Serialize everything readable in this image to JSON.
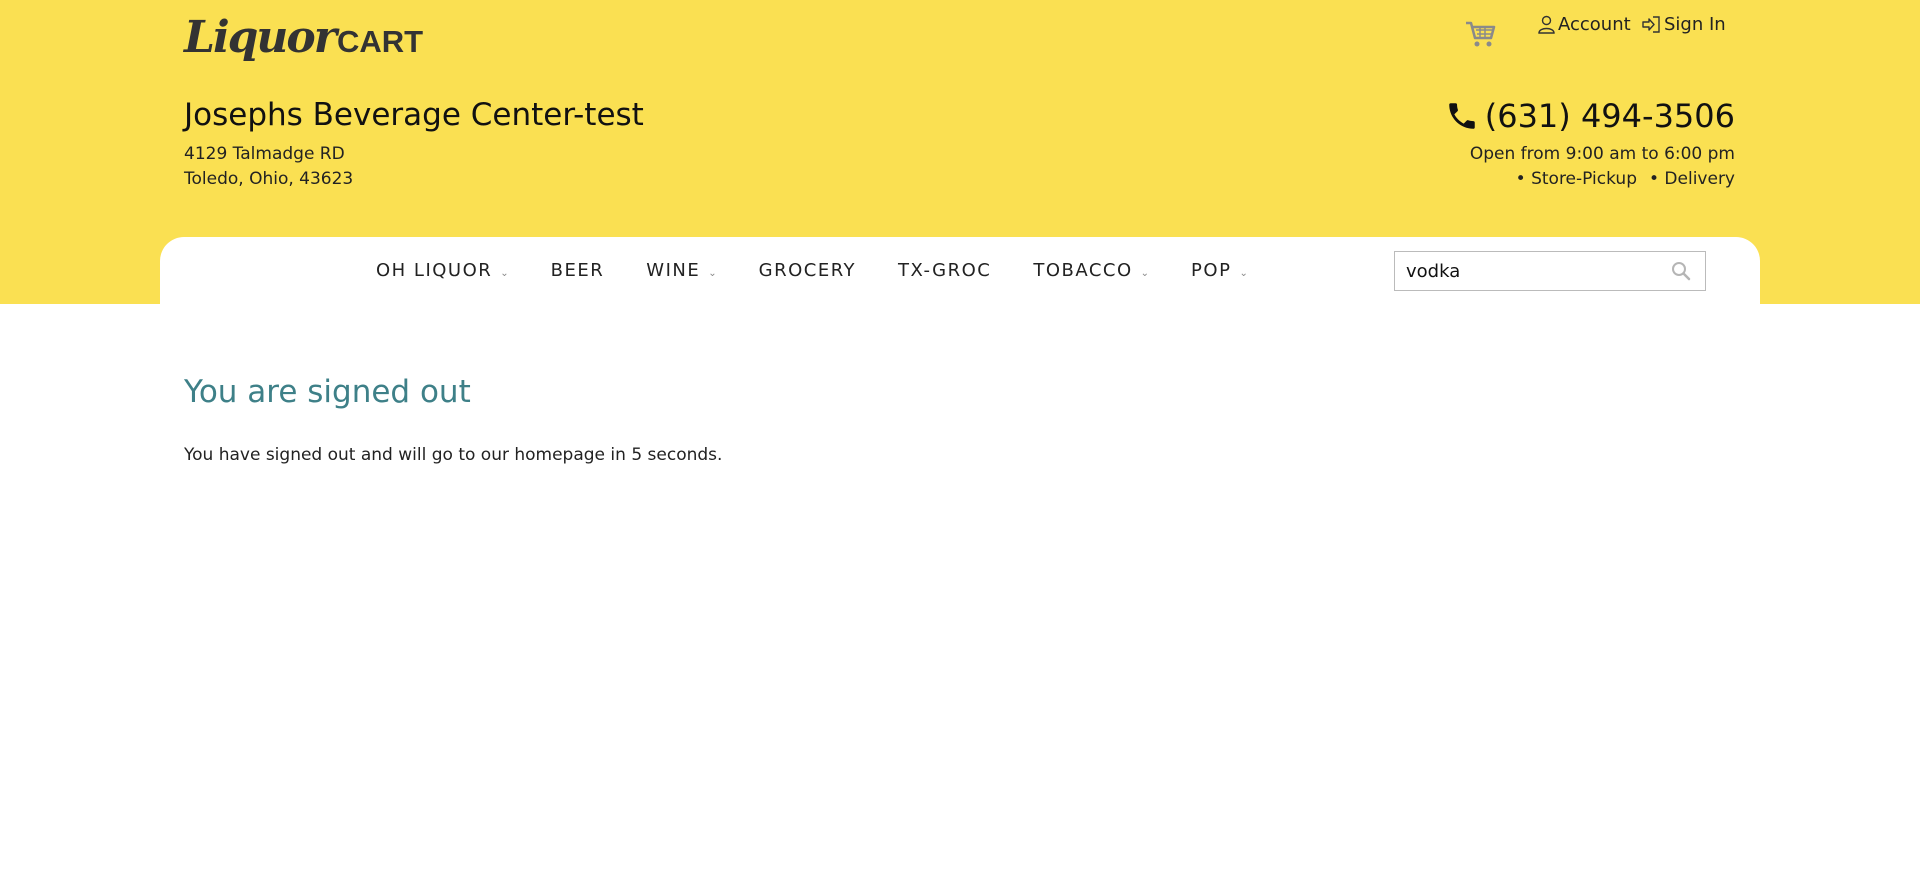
{
  "logo": {
    "script": "Liquor",
    "word": "CART"
  },
  "top_links": {
    "account": "Account",
    "sign_in": "Sign In"
  },
  "store": {
    "name": "Josephs Beverage Center-test",
    "address_line1": "4129 Talmadge RD",
    "address_line2": "Toledo, Ohio, 43623",
    "phone": "(631) 494-3506",
    "hours": "Open from 9:00 am to 6:00 pm",
    "services": [
      "• Store-Pickup",
      "• Delivery"
    ]
  },
  "nav": {
    "items": [
      {
        "label": "OH LIQUOR",
        "has_dropdown": true
      },
      {
        "label": "BEER",
        "has_dropdown": false
      },
      {
        "label": "WINE",
        "has_dropdown": true
      },
      {
        "label": "GROCERY",
        "has_dropdown": false
      },
      {
        "label": "TX-GROC",
        "has_dropdown": false
      },
      {
        "label": "TOBACCO",
        "has_dropdown": true
      },
      {
        "label": "POP",
        "has_dropdown": true
      }
    ],
    "caret": "⌄"
  },
  "search": {
    "value": "vodka"
  },
  "main": {
    "title": "You are signed out",
    "message": "You have signed out and will go to our homepage in 5 seconds."
  },
  "icons": {
    "cart": "cart-icon",
    "account": "user-icon",
    "sign_in": "sign-in-icon",
    "phone": "phone-icon",
    "search": "search-icon"
  },
  "colors": {
    "header_bg": "#fae052",
    "title": "#3e8088",
    "text": "#111111"
  }
}
